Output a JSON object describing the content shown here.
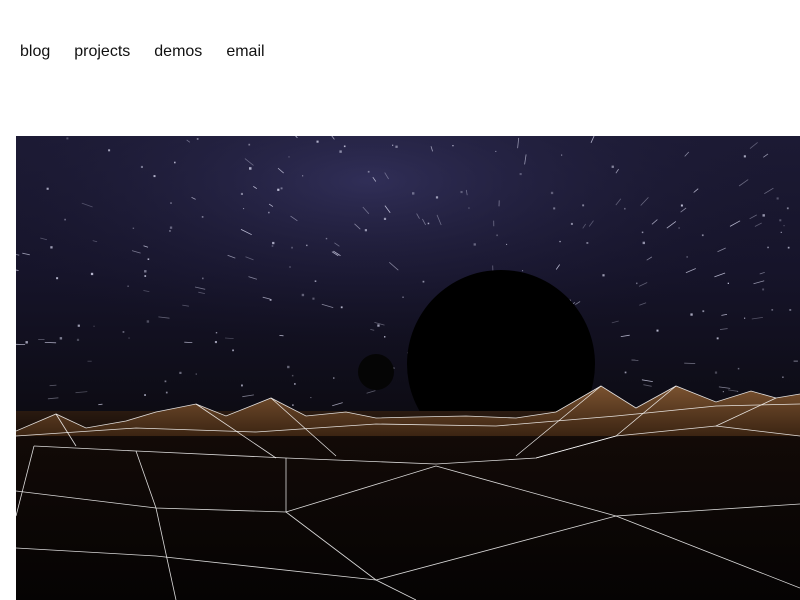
{
  "nav": {
    "items": [
      {
        "label": "blog"
      },
      {
        "label": "projects"
      },
      {
        "label": "demos"
      },
      {
        "label": "email"
      }
    ]
  },
  "scene": {
    "colors": {
      "sky_dark": "#0d0c16",
      "sky_tint": "#2c2a4e",
      "mountain": "#5a3b1e",
      "mountain_light": "#7a5230",
      "ground": "#0a0605",
      "wireframe": "#ffffff",
      "star": "#cfcfe6",
      "sun": "#000000"
    }
  }
}
